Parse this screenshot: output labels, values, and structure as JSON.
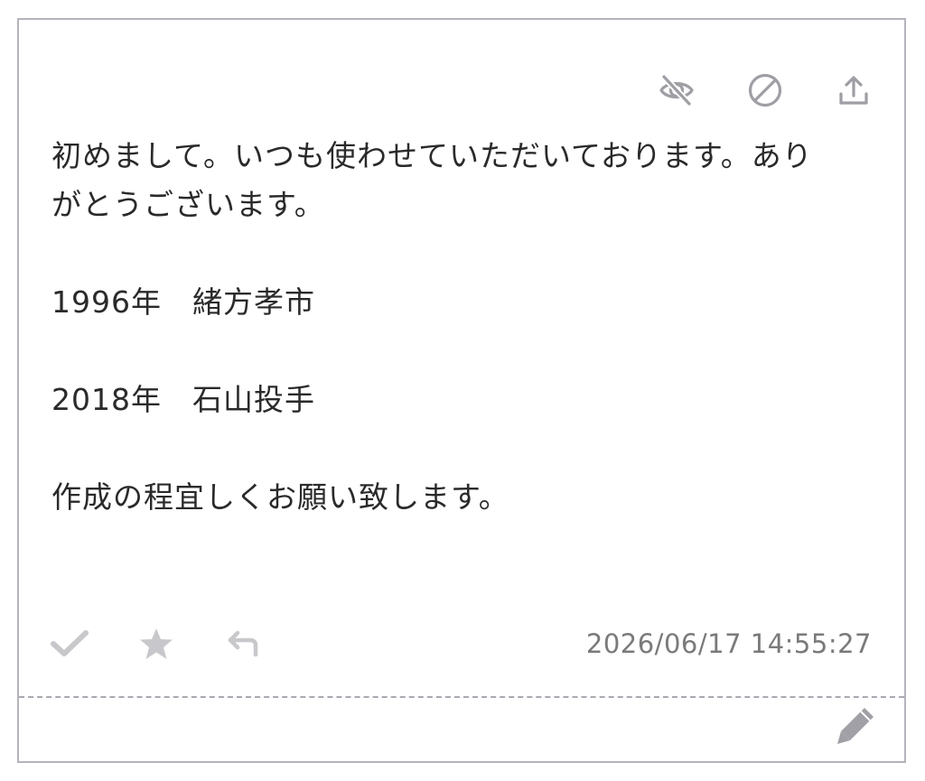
{
  "card": {
    "message_lines": [
      "初めまして。いつも使わせていただいております。あり",
      "がとうございます。",
      "",
      "1996年　緒方孝市",
      "",
      "2018年　石山投手",
      "",
      "作成の程宜しくお願い致します。"
    ],
    "timestamp": "2026/06/17 14:55:27"
  },
  "icons": {
    "hide": "eye-off-icon",
    "block": "block-icon",
    "share": "share-upload-icon",
    "check": "check-icon",
    "star": "star-icon",
    "reply": "reply-icon",
    "edit": "pencil-icon"
  },
  "colors": {
    "border": "#b4b4bc",
    "icon_gray": "#a8a8ae",
    "text": "#2a2a2a",
    "timestamp": "#7a7a7a"
  }
}
